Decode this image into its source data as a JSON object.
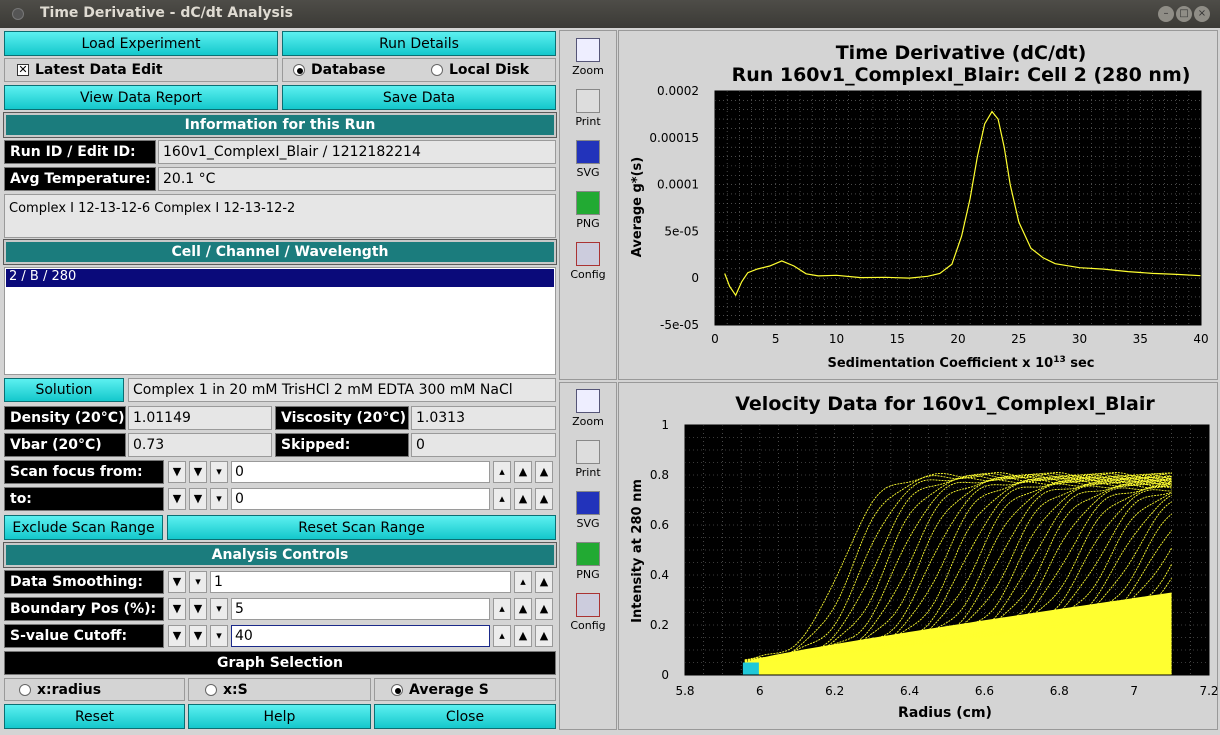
{
  "window": {
    "title": "Time Derivative - dC/dt Analysis"
  },
  "buttons": {
    "load_experiment": "Load Experiment",
    "run_details": "Run Details",
    "view_report": "View Data Report",
    "save_data": "Save Data",
    "solution": "Solution",
    "exclude_scan": "Exclude Scan Range",
    "reset_scan": "Reset Scan Range",
    "reset": "Reset",
    "help": "Help",
    "close": "Close"
  },
  "checks": {
    "latest_edit": "Latest Data Edit"
  },
  "source": {
    "database": "Database",
    "local_disk": "Local Disk"
  },
  "headers": {
    "info": "Information for this Run",
    "ccw": "Cell / Channel / Wavelength",
    "analysis": "Analysis Controls",
    "graph_selection": "Graph Selection"
  },
  "info": {
    "run_id_label": "Run ID / Edit ID:",
    "run_id": "160v1_ComplexI_Blair / 1212182214",
    "avg_temp_label": "Avg Temperature:",
    "avg_temp": "20.1 °C",
    "description": "Complex I 12-13-12-6  Complex I 12-13-12-2"
  },
  "ccw_list": [
    "2 / B / 280"
  ],
  "solution": {
    "value": "Complex 1 in 20 mM TrisHCl 2 mM EDTA 300 mM NaCl",
    "density_label": "Density (20°C)",
    "density": "1.01149",
    "viscosity_label": "Viscosity (20°C)",
    "viscosity": "1.0313",
    "vbar_label": "Vbar (20°C)",
    "vbar": "0.73",
    "skipped_label": "Skipped:",
    "skipped": "0"
  },
  "scan": {
    "from_label": "Scan focus from:",
    "from": "0",
    "to_label": "to:",
    "to": "0"
  },
  "controls": {
    "smoothing_label": "Data Smoothing:",
    "smoothing": "1",
    "boundary_label": "Boundary Pos (%):",
    "boundary": "5",
    "cutoff_label": "S-value Cutoff:",
    "cutoff": "40"
  },
  "graph": {
    "opt1": "x:radius",
    "opt2": "x:S",
    "opt3": "Average S"
  },
  "sidebar": {
    "zoom": "Zoom",
    "print": "Print",
    "svg": "SVG",
    "png": "PNG",
    "config": "Config"
  },
  "colors": {
    "plot_line": "#ffff30",
    "plot_bg": "#000000",
    "accent": "#1b7c7d",
    "button": "#22d0d4"
  },
  "chart_data": [
    {
      "type": "line",
      "title": "Time Derivative (dC/dt)",
      "subtitle": "Run 160v1_ComplexI_Blair: Cell 2 (280 nm)",
      "xlabel": "Sedimentation Coefficient x 10",
      "xlabel_sup": "13",
      "xlabel_tail": " sec",
      "ylabel": "Average g*(s)",
      "xlim": [
        0,
        40
      ],
      "ylim": [
        -5e-05,
        0.0002
      ],
      "xticks": [
        "0",
        "5",
        "10",
        "15",
        "20",
        "25",
        "30",
        "35",
        "40"
      ],
      "yticks": [
        "0.0002",
        "0.00015",
        "0.0001",
        "5e-05",
        "0",
        "-5e-05"
      ],
      "series": [
        {
          "x": [
            0.8,
            1.2,
            1.7,
            2.2,
            2.7,
            3.5,
            4.5,
            5.5,
            6.5,
            7.5,
            8.5,
            10,
            12,
            14,
            16,
            17.5,
            18.5,
            19.5,
            20.3,
            21,
            21.6,
            22.2,
            22.8,
            23.3,
            23.8,
            24.3,
            25,
            26,
            27,
            28,
            30,
            32,
            34,
            36,
            38,
            40
          ],
          "y": [
            5e-06,
            -8e-06,
            -1.7e-05,
            -2e-06,
            8e-06,
            1.2e-05,
            1.5e-05,
            2e-05,
            1.4e-05,
            5e-06,
            2e-06,
            2e-06,
            -1e-06,
            -1e-06,
            -2e-06,
            0.0,
            5e-06,
            1.5e-05,
            4.5e-05,
            8.5e-05,
            0.00013,
            0.000165,
            0.000178,
            0.00017,
            0.00014,
            0.0001,
            6e-05,
            3.2e-05,
            2.2e-05,
            1.5e-05,
            1e-05,
            8e-06,
            5e-06,
            3e-06,
            2e-06,
            1e-06
          ]
        }
      ]
    },
    {
      "type": "scatter",
      "title": "Velocity Data for 160v1_ComplexI_Blair",
      "xlabel": "Radius (cm)",
      "ylabel": "Intensity at 280 nm",
      "xlim": [
        5.8,
        7.2
      ],
      "ylim": [
        0,
        1
      ],
      "xticks": [
        "5.8",
        "6",
        "6.2",
        "6.4",
        "6.6",
        "6.8",
        "7",
        "7.2"
      ],
      "yticks": [
        "1",
        "0.8",
        "0.6",
        "0.4",
        "0.2",
        "0"
      ],
      "series": [
        {
          "name": "",
          "meniscus_x": 5.96,
          "bottom_x": 7.1,
          "plateau": 0.8,
          "base_left": 0.05,
          "base_right": 0.25
        }
      ]
    }
  ]
}
